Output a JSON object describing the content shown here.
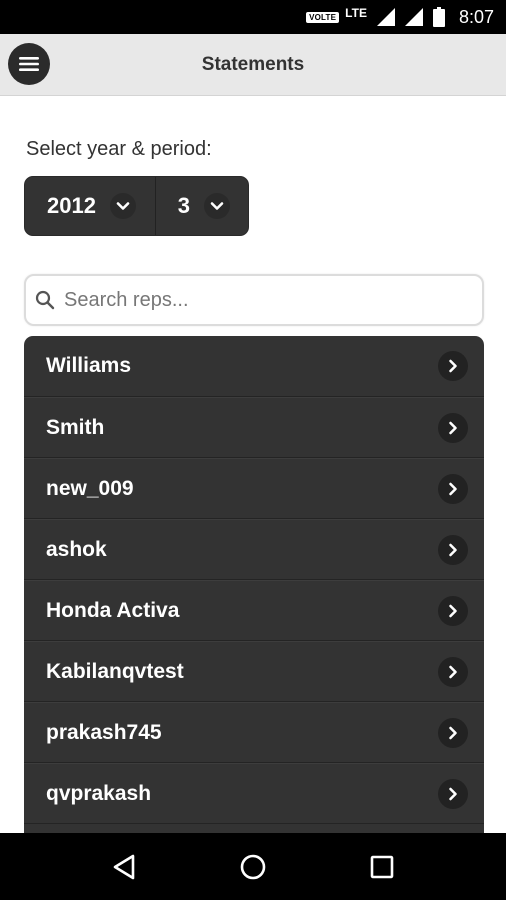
{
  "status_bar": {
    "volte": "VOLTE",
    "network": "LTE",
    "time": "8:07"
  },
  "header": {
    "title": "Statements",
    "menu_icon": "hamburger-icon"
  },
  "filters": {
    "label": "Select year & period:",
    "year": "2012",
    "period": "3"
  },
  "search": {
    "placeholder": "Search reps...",
    "value": ""
  },
  "reps": [
    {
      "name": "Williams"
    },
    {
      "name": "Smith"
    },
    {
      "name": "new_009"
    },
    {
      "name": "ashok"
    },
    {
      "name": "Honda Activa"
    },
    {
      "name": "Kabilanqvtest"
    },
    {
      "name": "prakash745"
    },
    {
      "name": "qvprakash"
    }
  ],
  "colors": {
    "list_bg": "#333333",
    "header_bg": "#e8e8e8",
    "accent_dark": "#2b2b2b"
  }
}
